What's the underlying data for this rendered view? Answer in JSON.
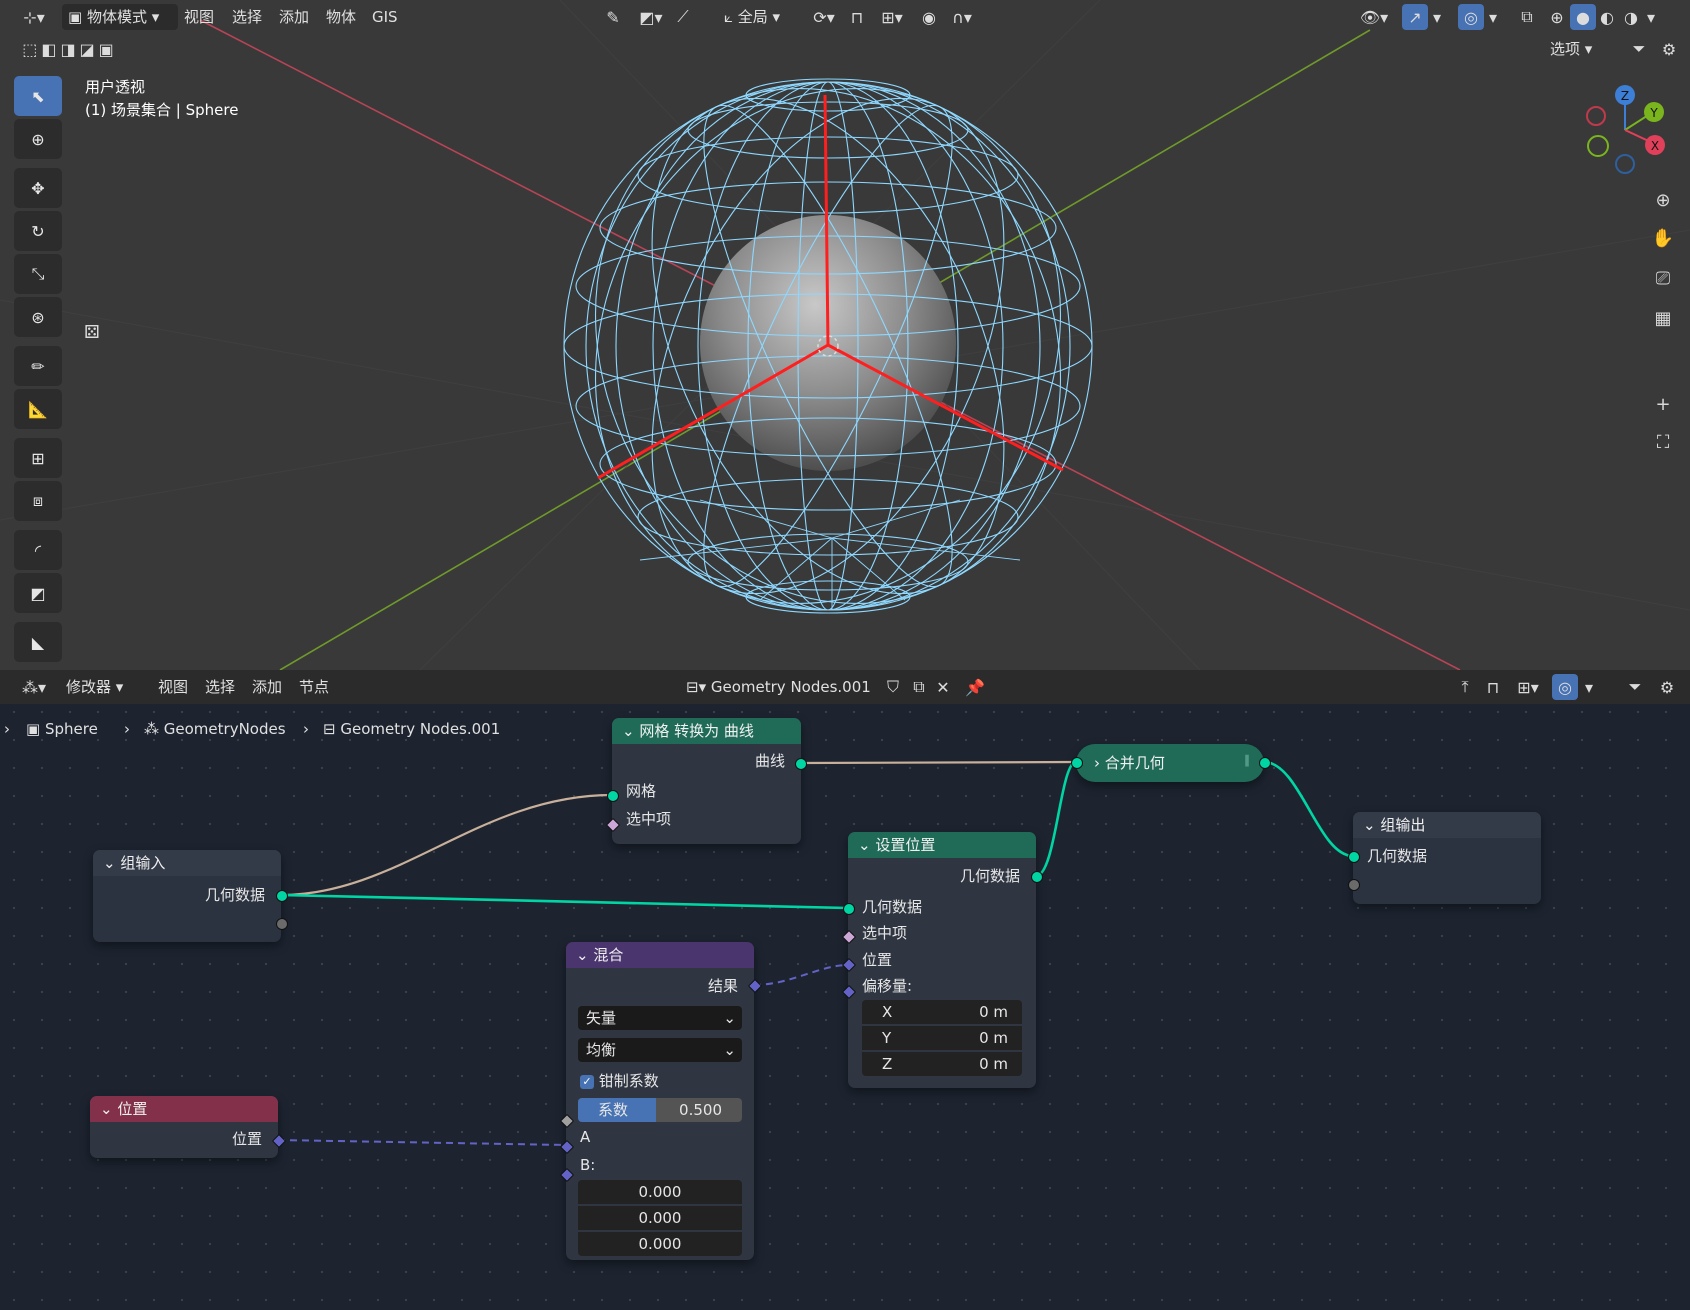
{
  "viewport": {
    "mode_label": "物体模式",
    "menu": [
      "视图",
      "选择",
      "添加",
      "物体",
      "GIS"
    ],
    "transform_orientation": "全局",
    "options_label": "选项",
    "view_name": "用户透视",
    "object_info": "(1) 场景集合 | Sphere",
    "axis_labels": {
      "x": "X",
      "y": "Y",
      "z": "Z"
    }
  },
  "node_editor": {
    "editor_type": "修改器",
    "menu": [
      "视图",
      "选择",
      "添加",
      "节点"
    ],
    "node_tree_name": "Geometry Nodes.001",
    "breadcrumb": [
      "Sphere",
      "GeometryNodes",
      "Geometry Nodes.001"
    ],
    "nodes": {
      "mesh_to_curve": {
        "title": "网格 转换为 曲线",
        "output": "曲线",
        "input_mesh": "网格",
        "input_selection": "选中项"
      },
      "join_geometry": {
        "title": "合并几何"
      },
      "group_output": {
        "title": "组输出",
        "input": "几何数据"
      },
      "group_input": {
        "title": "组输入",
        "output": "几何数据"
      },
      "set_position": {
        "title": "设置位置",
        "output": "几何数据",
        "in_geometry": "几何数据",
        "in_selection": "选中项",
        "in_position": "位置",
        "in_offset": "偏移量:",
        "offset_x_label": "X",
        "offset_x": "0 m",
        "offset_y_label": "Y",
        "offset_y": "0 m",
        "offset_z_label": "Z",
        "offset_z": "0 m"
      },
      "mix": {
        "title": "混合",
        "output": "结果",
        "data_type": "矢量",
        "mode": "均衡",
        "clamp_label": "钳制系数",
        "clamp_checked": true,
        "factor_label": "系数",
        "factor_value": "0.500",
        "input_a": "A",
        "input_b": "B:",
        "b_x": "0.000",
        "b_y": "0.000",
        "b_z": "0.000"
      },
      "position": {
        "title": "位置",
        "output": "位置"
      }
    }
  },
  "colors": {
    "accent": "#4772b3",
    "geometry_socket": "#00d6a3",
    "vector_socket": "#6363c7",
    "wire_mesh": "#8ed8ff",
    "normal_lines": "#ff2020",
    "x_axis_line": "#c44a5a",
    "y_axis_line": "#6f9a2a",
    "header_geometry": "#1f6b58",
    "header_mix": "#4a356e",
    "header_input": "#83314a"
  }
}
